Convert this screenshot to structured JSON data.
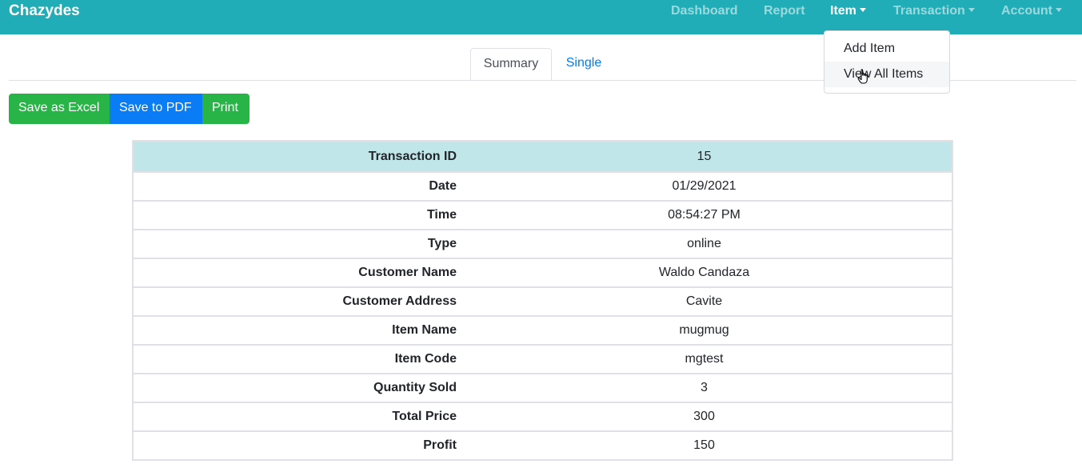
{
  "navbar": {
    "brand": "Chazydes",
    "links": {
      "dashboard": "Dashboard",
      "report": "Report",
      "item": "Item",
      "transaction": "Transaction",
      "account": "Account"
    },
    "bg_color": "#20adb7"
  },
  "dropdown": {
    "items": [
      "Add Item",
      "View All Items"
    ],
    "hovered": "View All Items"
  },
  "tabs": {
    "summary": "Summary",
    "single": "Single",
    "active": "Summary"
  },
  "actions": {
    "excel": "Save as Excel",
    "pdf": "Save to PDF",
    "print": "Print"
  },
  "table": {
    "rows": [
      {
        "label": "Transaction ID",
        "value": "15"
      },
      {
        "label": "Date",
        "value": "01/29/2021"
      },
      {
        "label": "Time",
        "value": "08:54:27 PM"
      },
      {
        "label": "Type",
        "value": "online"
      },
      {
        "label": "Customer Name",
        "value": "Waldo Candaza"
      },
      {
        "label": "Customer Address",
        "value": "Cavite"
      },
      {
        "label": "Item Name",
        "value": "mugmug"
      },
      {
        "label": "Item Code",
        "value": "mgtest"
      },
      {
        "label": "Quantity Sold",
        "value": "3"
      },
      {
        "label": "Total Price",
        "value": "300"
      },
      {
        "label": "Profit",
        "value": "150"
      }
    ]
  },
  "icons": {
    "cursor": "hand-pointer-icon",
    "caret": "caret-down-icon"
  }
}
